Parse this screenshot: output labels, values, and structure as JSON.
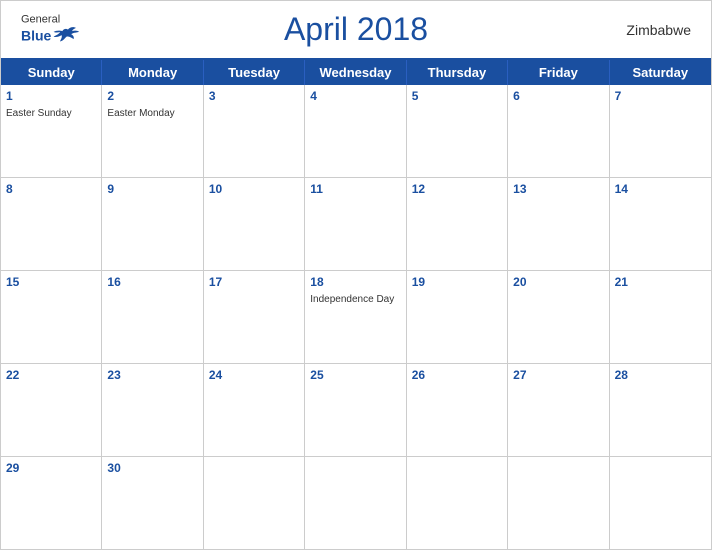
{
  "header": {
    "title": "April 2018",
    "country": "Zimbabwe",
    "logo": {
      "general": "General",
      "blue": "Blue"
    }
  },
  "days_of_week": [
    "Sunday",
    "Monday",
    "Tuesday",
    "Wednesday",
    "Thursday",
    "Friday",
    "Saturday"
  ],
  "weeks": [
    [
      {
        "number": "1",
        "event": "Easter Sunday"
      },
      {
        "number": "2",
        "event": "Easter Monday"
      },
      {
        "number": "3",
        "event": ""
      },
      {
        "number": "4",
        "event": ""
      },
      {
        "number": "5",
        "event": ""
      },
      {
        "number": "6",
        "event": ""
      },
      {
        "number": "7",
        "event": ""
      }
    ],
    [
      {
        "number": "8",
        "event": ""
      },
      {
        "number": "9",
        "event": ""
      },
      {
        "number": "10",
        "event": ""
      },
      {
        "number": "11",
        "event": ""
      },
      {
        "number": "12",
        "event": ""
      },
      {
        "number": "13",
        "event": ""
      },
      {
        "number": "14",
        "event": ""
      }
    ],
    [
      {
        "number": "15",
        "event": ""
      },
      {
        "number": "16",
        "event": ""
      },
      {
        "number": "17",
        "event": ""
      },
      {
        "number": "18",
        "event": "Independence Day"
      },
      {
        "number": "19",
        "event": ""
      },
      {
        "number": "20",
        "event": ""
      },
      {
        "number": "21",
        "event": ""
      }
    ],
    [
      {
        "number": "22",
        "event": ""
      },
      {
        "number": "23",
        "event": ""
      },
      {
        "number": "24",
        "event": ""
      },
      {
        "number": "25",
        "event": ""
      },
      {
        "number": "26",
        "event": ""
      },
      {
        "number": "27",
        "event": ""
      },
      {
        "number": "28",
        "event": ""
      }
    ],
    [
      {
        "number": "29",
        "event": ""
      },
      {
        "number": "30",
        "event": ""
      },
      {
        "number": "",
        "event": ""
      },
      {
        "number": "",
        "event": ""
      },
      {
        "number": "",
        "event": ""
      },
      {
        "number": "",
        "event": ""
      },
      {
        "number": "",
        "event": ""
      }
    ]
  ]
}
